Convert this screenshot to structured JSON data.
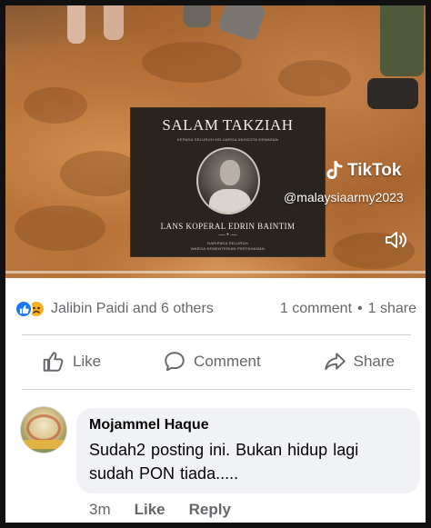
{
  "video": {
    "memorial_title": "SALAM TAKZIAH",
    "memorial_subtitle": "KEPADA SELURUH KELUARGA ANGGOTA KEMASAN",
    "memorial_name": "LANS KOPERAL EDRIN BAINTIM",
    "memorial_footer_1": "DARIPADA SELURUH",
    "memorial_footer_2": "WARGA KEMENTERIAN PERTAHANAN",
    "tiktok_logo_text": "TikTok",
    "tiktok_handle": "@malaysiaarmy2023",
    "icons": {
      "logo": "tiktok-logo-icon",
      "volume": "volume-icon"
    }
  },
  "reactions": {
    "names": "Jalibin Paidi and 6 others",
    "comments": "1 comment",
    "separator": "•",
    "shares": "1 share",
    "icons": [
      "like-reaction-icon",
      "sad-reaction-icon"
    ],
    "colors": {
      "like": "#1877f2",
      "sad": "#f7b125"
    }
  },
  "actions": {
    "like": "Like",
    "comment": "Comment",
    "share": "Share"
  },
  "comment": {
    "author": "Mojammel Haque",
    "text_line1": "Sudah2 posting ini.  Bukan hidup lagi",
    "text_line2": "sudah PON tiada.....",
    "time": "3m",
    "like_label": "Like",
    "reply_label": "Reply"
  },
  "colors": {
    "secondary_text": "#65676b",
    "bubble": "#f0f2f5",
    "divider": "#ced0d4"
  }
}
